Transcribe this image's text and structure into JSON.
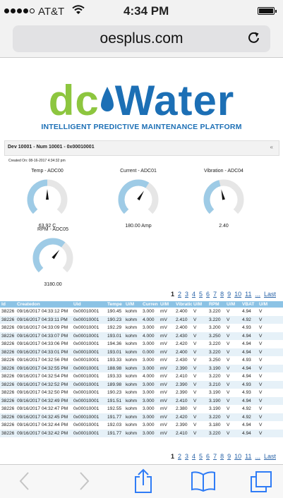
{
  "status_bar": {
    "carrier": "AT&T",
    "time": "4:34 PM"
  },
  "browser": {
    "url": "oesplus.com"
  },
  "logo": {
    "dc": "dc",
    "water": "Water",
    "tagline": "INTELLIGENT PREDICTIVE MAINTENANCE PLATFORM"
  },
  "device": {
    "title": "Dev 10001 - Num 10001 - 0x00010001",
    "collapse": "«",
    "created_on": "Created On: 08-16-2017 4:34:32 pm"
  },
  "gauges": [
    {
      "title": "Temp - ADC00",
      "value": "63.92 C",
      "level": 0.5
    },
    {
      "title": "Current - ADC01",
      "value": "180.00 Amp",
      "level": 0.62
    },
    {
      "title": "Vibration - ADC04",
      "value": "2.40",
      "level": 0.45
    },
    {
      "title": "RPM - ADC05",
      "value": "3180.00",
      "level": 0.64
    }
  ],
  "pagination": {
    "pages": [
      "1",
      "2",
      "3",
      "4",
      "5",
      "6",
      "7",
      "8",
      "9",
      "10",
      "11"
    ],
    "current": "1",
    "more": "...",
    "last": "Last"
  },
  "table": {
    "headers": [
      "Id",
      "Createdon",
      "Uid",
      "Tempe",
      "U/M",
      "Curren",
      "U/M",
      "Vibratio",
      "U/M",
      "RPM",
      "U/M",
      "VBAT",
      "U/M"
    ],
    "rows": [
      [
        "38226",
        "09/16/2017 04:33:12 PM",
        "0x00010001",
        "190.45",
        "kohm",
        "3.000",
        "mV",
        "2.400",
        "V",
        "3.220",
        "V",
        "4.94",
        "V"
      ],
      [
        "38226",
        "09/16/2017 04:33:11 PM",
        "0x00010001",
        "190.23",
        "kohm",
        "4.000",
        "mV",
        "2.410",
        "V",
        "3.220",
        "V",
        "4.92",
        "V"
      ],
      [
        "38226",
        "09/16/2017 04:33:09 PM",
        "0x00010001",
        "192.29",
        "kohm",
        "3.000",
        "mV",
        "2.400",
        "V",
        "3.200",
        "V",
        "4.93",
        "V"
      ],
      [
        "38226",
        "09/16/2017 04:33:07 PM",
        "0x00010001",
        "193.01",
        "kohm",
        "4.000",
        "mV",
        "2.430",
        "V",
        "3.250",
        "V",
        "4.94",
        "V"
      ],
      [
        "38226",
        "09/16/2017 04:33:06 PM",
        "0x00010001",
        "194.36",
        "kohm",
        "3.000",
        "mV",
        "2.420",
        "V",
        "3.220",
        "V",
        "4.94",
        "V"
      ],
      [
        "38226",
        "09/16/2017 04:33:01 PM",
        "0x00010001",
        "193.01",
        "kohm",
        "0.000",
        "mV",
        "2.400",
        "V",
        "3.220",
        "V",
        "4.94",
        "V"
      ],
      [
        "38226",
        "09/16/2017 04:32:56 PM",
        "0x00010001",
        "193.33",
        "kohm",
        "3.000",
        "mV",
        "2.430",
        "V",
        "3.250",
        "V",
        "4.93",
        "V"
      ],
      [
        "38226",
        "09/16/2017 04:32:55 PM",
        "0x00010001",
        "188.98",
        "kohm",
        "3.000",
        "mV",
        "2.390",
        "V",
        "3.190",
        "V",
        "4.94",
        "V"
      ],
      [
        "38226",
        "09/16/2017 04:32:54 PM",
        "0x00010001",
        "193.33",
        "kohm",
        "4.000",
        "mV",
        "2.410",
        "V",
        "3.220",
        "V",
        "4.94",
        "V"
      ],
      [
        "38226",
        "09/16/2017 04:32:52 PM",
        "0x00010001",
        "189.98",
        "kohm",
        "3.000",
        "mV",
        "2.390",
        "V",
        "3.210",
        "V",
        "4.93",
        "V"
      ],
      [
        "38226",
        "09/16/2017 04:32:50 PM",
        "0x00010001",
        "190.23",
        "kohm",
        "3.000",
        "mV",
        "2.390",
        "V",
        "3.190",
        "V",
        "4.93",
        "V"
      ],
      [
        "38226",
        "09/16/2017 04:32:49 PM",
        "0x00010001",
        "191.51",
        "kohm",
        "3.000",
        "mV",
        "2.410",
        "V",
        "3.190",
        "V",
        "4.94",
        "V"
      ],
      [
        "38226",
        "09/16/2017 04:32:47 PM",
        "0x00010001",
        "192.55",
        "kohm",
        "3.000",
        "mV",
        "2.380",
        "V",
        "3.190",
        "V",
        "4.92",
        "V"
      ],
      [
        "38226",
        "09/16/2017 04:32:45 PM",
        "0x00010001",
        "191.77",
        "kohm",
        "3.000",
        "mV",
        "2.420",
        "V",
        "3.220",
        "V",
        "4.92",
        "V"
      ],
      [
        "38226",
        "09/16/2017 04:32:44 PM",
        "0x00010001",
        "192.03",
        "kohm",
        "3.000",
        "mV",
        "2.390",
        "V",
        "3.180",
        "V",
        "4.94",
        "V"
      ],
      [
        "38226",
        "09/16/2017 04:32:42 PM",
        "0x00010001",
        "191.77",
        "kohm",
        "3.000",
        "mV",
        "2.410",
        "V",
        "3.220",
        "V",
        "4.94",
        "V"
      ]
    ]
  },
  "toolbar": {
    "icons": [
      "back-chevron",
      "forward-chevron",
      "share",
      "bookmarks",
      "tabs"
    ]
  },
  "colors": {
    "gauge_fill": "#9ecbe6",
    "gauge_track": "#e6e6e6",
    "header_bg": "#8cc3e5",
    "link": "#2a64a8",
    "logo_green": "#8dc63f",
    "logo_blue": "#1c6fb5"
  }
}
